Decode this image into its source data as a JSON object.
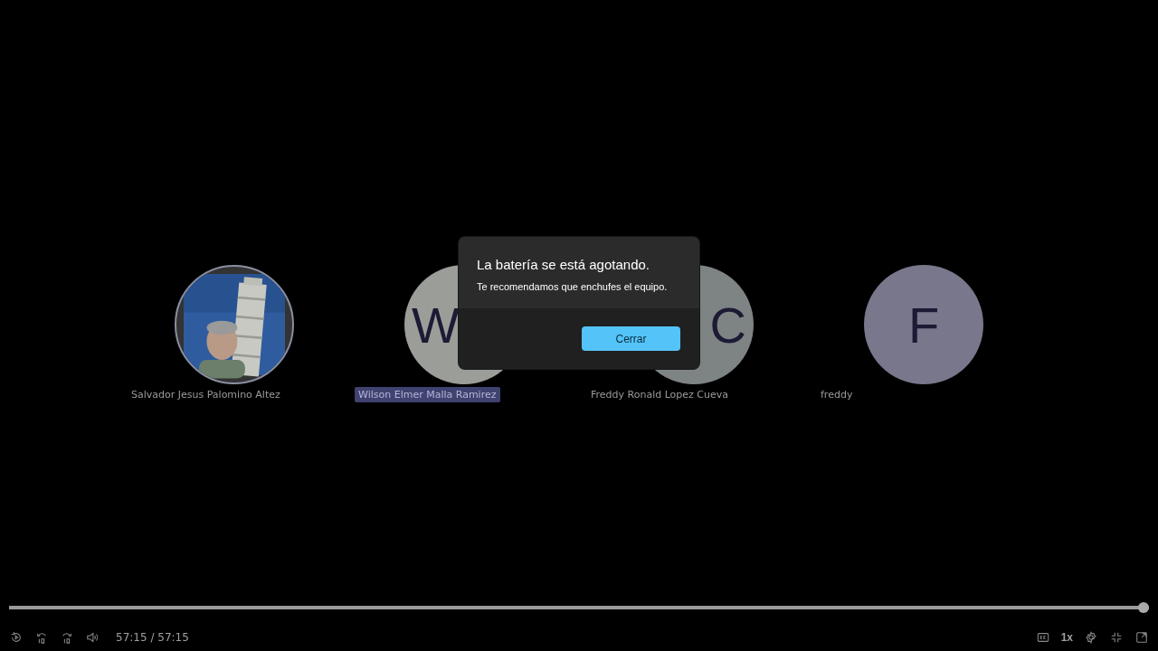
{
  "participants": [
    {
      "name": "Salvador Jesus Palomino Altez",
      "speaking": false
    },
    {
      "name": "Wilson Elmer Malla Ramirez",
      "kind": "initial",
      "initial": "W",
      "color": "#9b9d99",
      "speaking": true
    },
    {
      "name": "Freddy Ronald Lopez Cueva",
      "kind": "initial",
      "initial": "C",
      "color": "#7e8384",
      "speaking": false
    },
    {
      "name": "freddy",
      "kind": "initial",
      "initial": "F",
      "color": "#78778b",
      "speaking": false
    }
  ],
  "dialog": {
    "title": "La batería se está agotando.",
    "message": "Te recomendamos que enchufes el equipo.",
    "button": "Cerrar"
  },
  "player": {
    "progress": {
      "level": 1
    },
    "time": "57:15 / 57:15",
    "speed": "1x"
  }
}
